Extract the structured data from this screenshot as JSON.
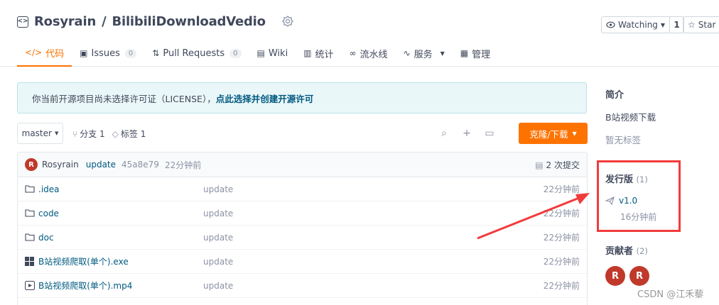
{
  "repo": {
    "owner": "Rosyrain",
    "separator": "/",
    "name": "BilibiliDownloadVedio"
  },
  "watch": {
    "label": "Watching",
    "count": "1"
  },
  "star": {
    "label": "Star"
  },
  "tabs": [
    {
      "label": "代码",
      "icon": "code-icon",
      "active": true
    },
    {
      "label": "Issues",
      "icon": "issue-icon",
      "count": "0"
    },
    {
      "label": "Pull Requests",
      "icon": "pull-request-icon",
      "count": "0"
    },
    {
      "label": "Wiki",
      "icon": "book-icon"
    },
    {
      "label": "统计",
      "icon": "stats-icon"
    },
    {
      "label": "流水线",
      "icon": "pipeline-icon"
    },
    {
      "label": "服务",
      "icon": "pulse-icon",
      "dropdown": true
    },
    {
      "label": "管理",
      "icon": "manage-icon"
    }
  ],
  "notice": {
    "text": "你当前开源项目尚未选择许可证（LICENSE），",
    "link": "点此选择并创建开源许可"
  },
  "branch": {
    "current": "master",
    "branches_label": "分支 1",
    "tags_label": "标签 1"
  },
  "clone_label": "克隆/下载",
  "commit": {
    "avatar": "R",
    "author": "Rosyrain",
    "message": "update",
    "sha": "45a8e79",
    "time": "22分钟前",
    "count_label": "2 次提交"
  },
  "files": [
    {
      "name": ".idea",
      "type": "folder",
      "message": "update",
      "time": "22分钟前"
    },
    {
      "name": "code",
      "type": "folder",
      "message": "update",
      "time": "22分钟前"
    },
    {
      "name": "doc",
      "type": "folder",
      "message": "update",
      "time": "22分钟前"
    },
    {
      "name": "B站视频爬取(单个).exe",
      "type": "exe",
      "message": "update",
      "time": "22分钟前"
    },
    {
      "name": "B站视频爬取(单个).mp4",
      "type": "video",
      "message": "update",
      "time": "22分钟前"
    }
  ],
  "sidebar": {
    "intro_title": "简介",
    "intro_text": "B站视频下载",
    "no_tags": "暂无标签",
    "release_title": "发行版",
    "release_count": "(1)",
    "release_version": "v1.0",
    "release_time": "16分钟前",
    "contributors_title": "贡献者",
    "contributors_count": "(2)",
    "contributors": [
      "R",
      "R"
    ]
  },
  "watermark": "CSDN @江禾藜",
  "colors": {
    "accent": "#fe7300",
    "link": "#005980",
    "annotation": "#f23b3b"
  }
}
